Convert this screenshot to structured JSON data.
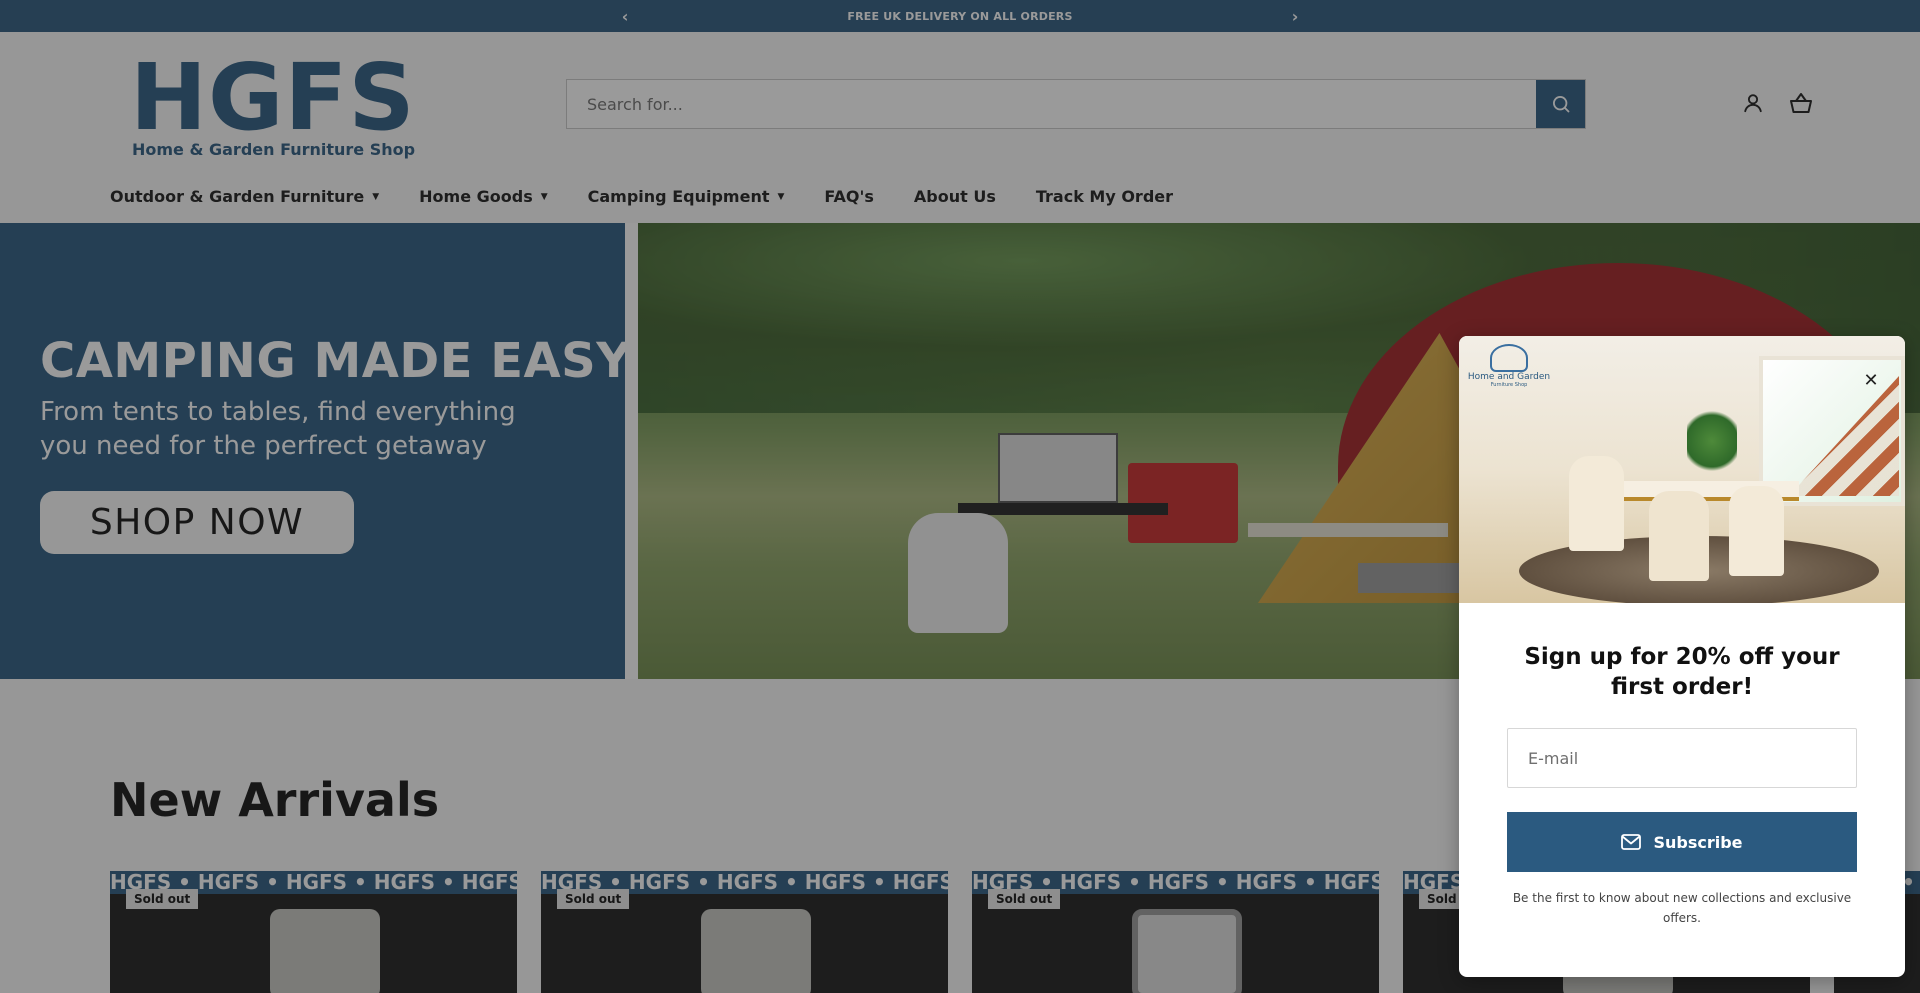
{
  "announcement": {
    "text": "FREE UK DELIVERY ON ALL ORDERS",
    "prev_icon": "chevron-left-icon",
    "next_icon": "chevron-right-icon"
  },
  "logo": {
    "wordmark": "HGFS",
    "tagline": "Home & Garden Furniture Shop"
  },
  "search": {
    "placeholder": "Search for...",
    "button_icon": "search-icon"
  },
  "header_icons": [
    "account-icon",
    "cart-icon"
  ],
  "nav": {
    "items": [
      {
        "label": "Outdoor & Garden Furniture",
        "has_dropdown": true
      },
      {
        "label": "Home Goods",
        "has_dropdown": true
      },
      {
        "label": "Camping Equipment",
        "has_dropdown": true
      },
      {
        "label": "FAQ's",
        "has_dropdown": false
      },
      {
        "label": "About Us",
        "has_dropdown": false
      },
      {
        "label": "Track My Order",
        "has_dropdown": false
      }
    ]
  },
  "hero": {
    "title": "CAMPING MADE EASY",
    "subtitle": "From tents to tables, find everything you need for the perfrect getaway",
    "button": "SHOP NOW"
  },
  "arrivals": {
    "title": "New Arrivals",
    "strip_text": "HGFS • HGFS • HGFS • HGFS • HGFS • HGFS",
    "cards": [
      {
        "badge": "Sold out"
      },
      {
        "badge": "Sold out"
      },
      {
        "badge": "Sold out"
      },
      {
        "badge": "Sold out"
      }
    ]
  },
  "popup": {
    "logo_name": "Home and Garden",
    "logo_tagline": "Furniture Shop",
    "title": "Sign up for 20% off your first order!",
    "email_placeholder": "E-mail",
    "subscribe_label": "Subscribe",
    "subscribe_icon": "mail-icon",
    "note": "Be the first to know about new collections and exclusive offers.",
    "close_icon": "close-icon"
  },
  "colors": {
    "brand": "#2b5a80",
    "announcement_bg": "#2d5a7e",
    "overlay": "rgba(30,30,30,0.45)"
  }
}
